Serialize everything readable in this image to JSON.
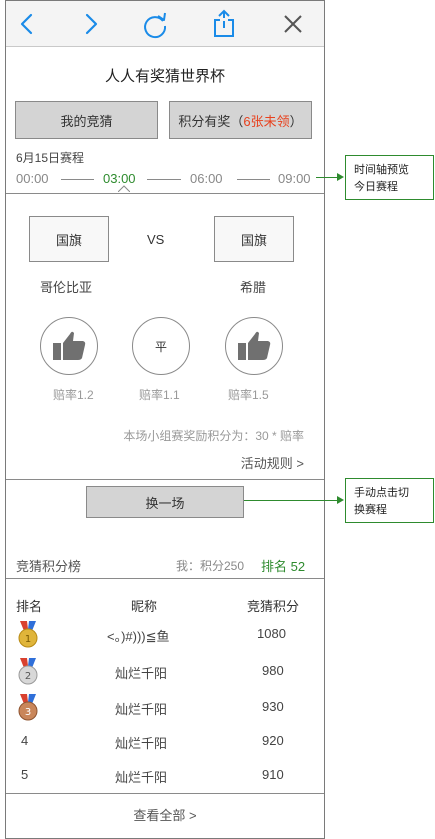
{
  "page": {
    "title": "人人有奖猜世界杯"
  },
  "toolbar": {
    "back": "chevron-left-icon",
    "forward": "chevron-right-icon",
    "refresh": "refresh-icon",
    "share": "share-icon",
    "close": "close-icon"
  },
  "tabs": {
    "my_guess": "我的竞猜",
    "points_prefix": "积分有奖（",
    "points_highlight": "6张未领",
    "points_suffix": "）"
  },
  "schedule": {
    "date_label": "6月15日赛程",
    "times": [
      "00:00",
      "03:00",
      "06:00",
      "09:00"
    ],
    "active_index": 1
  },
  "match": {
    "home_flag": "国旗",
    "away_flag": "国旗",
    "vs": "VS",
    "home_team": "哥伦比亚",
    "away_team": "希腊",
    "draw_label": "平",
    "odds": [
      "赔率1.2",
      "赔率1.1",
      "赔率1.5"
    ],
    "reward_note": "本场小组赛奖励积分为：30 * 赔率",
    "rules_link": "活动规则 >"
  },
  "switch_button": "换一场",
  "leaderboard": {
    "title": "竞猜积分榜",
    "my_score": "我：积分250",
    "my_rank": "排名 52",
    "headers": [
      "排名",
      "昵称",
      "竞猜积分"
    ],
    "rows": [
      {
        "rank": "1",
        "name": "<。)#)))≦鱼",
        "score": "1080"
      },
      {
        "rank": "2",
        "name": "灿烂千阳",
        "score": "980"
      },
      {
        "rank": "3",
        "name": "灿烂千阳",
        "score": "930"
      },
      {
        "rank": "4",
        "name": "灿烂千阳",
        "score": "920"
      },
      {
        "rank": "5",
        "name": "灿烂千阳",
        "score": "910"
      }
    ],
    "view_all": "查看全部 >"
  },
  "annotations": {
    "timeline_note": [
      "时间轴预览",
      "今日赛程"
    ],
    "switch_note": [
      "手动点击切",
      "换赛程"
    ]
  },
  "colors": {
    "accent_green": "#2e8b2e",
    "highlight_red": "#e8411d",
    "icon_blue": "#1a8be8",
    "button_gray": "#d4d4d4"
  }
}
